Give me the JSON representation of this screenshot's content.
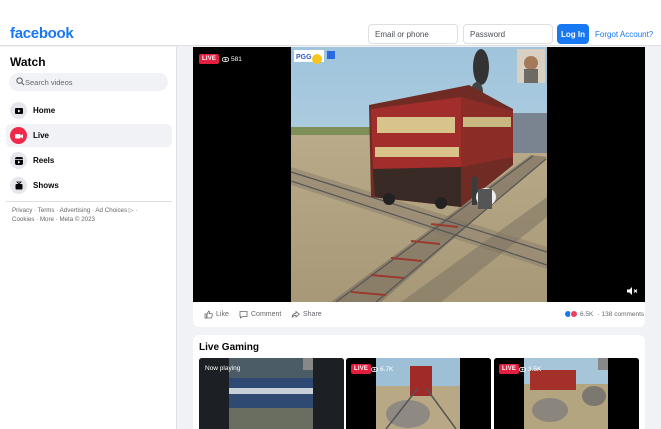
{
  "header": {
    "logo": "facebook",
    "email_placeholder": "Email or phone",
    "password_placeholder": "Password",
    "login_label": "Log In",
    "forgot_label": "Forgot Account?"
  },
  "sidebar": {
    "title": "Watch",
    "search_placeholder": "Search videos",
    "items": [
      {
        "label": "Home",
        "icon": "home-icon",
        "active": false
      },
      {
        "label": "Live",
        "icon": "live-camera-icon",
        "active": true
      },
      {
        "label": "Reels",
        "icon": "reels-icon",
        "active": false
      },
      {
        "label": "Shows",
        "icon": "shows-icon",
        "active": false
      }
    ],
    "footer": [
      "Privacy · Terms · Advertising · Ad Choices ▷ ·",
      "Cookies · More · Meta © 2023"
    ]
  },
  "video": {
    "live_label": "LIVE",
    "viewers": "581",
    "like_label": "Like",
    "comment_label": "Comment",
    "share_label": "Share",
    "reactions_count": "6.5K",
    "comments_count": "138 comments"
  },
  "live_gaming": {
    "title": "Live Gaming",
    "items": [
      {
        "now_playing": "Now playing",
        "live_label": "",
        "viewers": ""
      },
      {
        "now_playing": "",
        "live_label": "LIVE",
        "viewers": "6.7K"
      },
      {
        "now_playing": "",
        "live_label": "LIVE",
        "viewers": "3.5K"
      }
    ]
  },
  "colors": {
    "brand": "#1877f2",
    "live": "#e41e3f",
    "background": "#f0f2f5"
  }
}
